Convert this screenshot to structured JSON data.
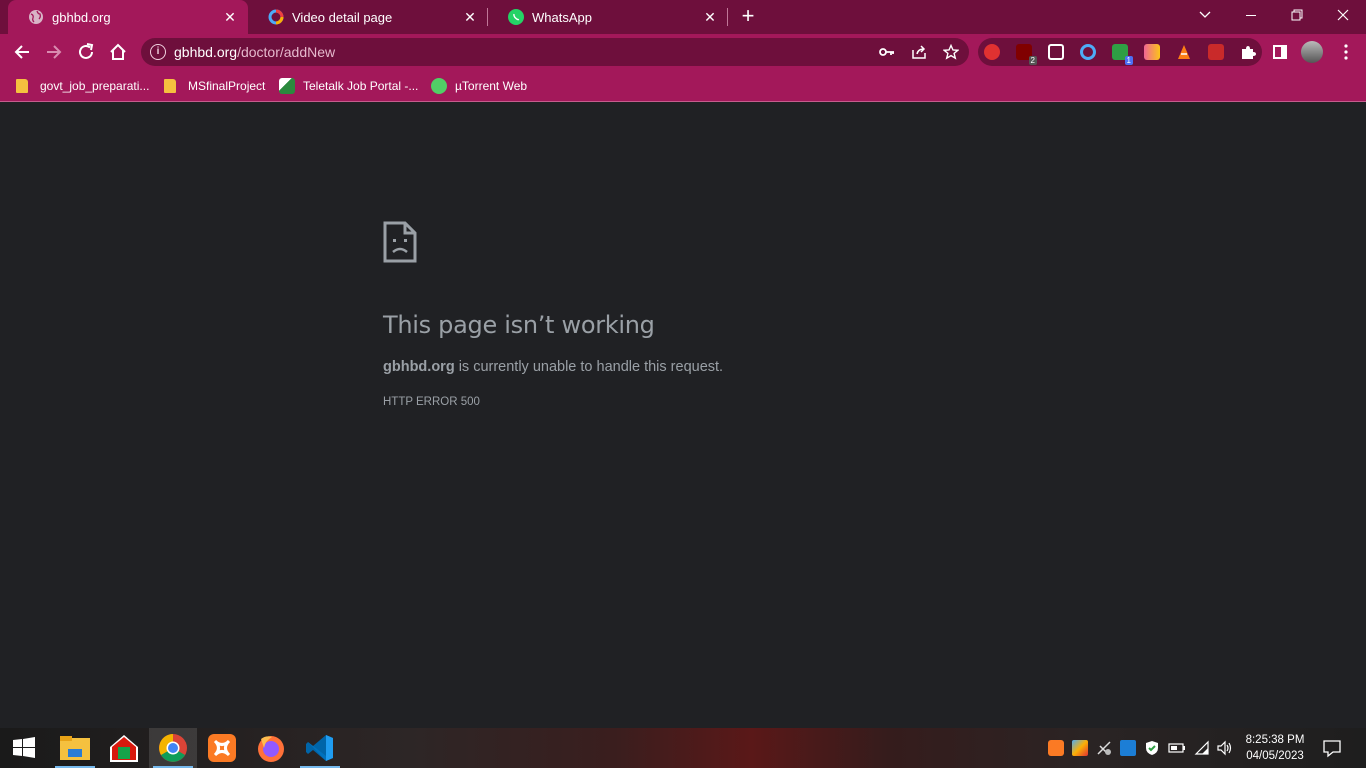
{
  "browser": {
    "tabs": [
      {
        "title": "gbhbd.org",
        "active": true,
        "icon": "globe-icon"
      },
      {
        "title": "Video detail page",
        "active": false,
        "icon": "colorful-ring-icon"
      },
      {
        "title": "WhatsApp",
        "active": false,
        "icon": "whatsapp-icon"
      }
    ],
    "new_tab_label": "+",
    "url_host": "gbhbd.org",
    "url_path": "/doctor/addNew",
    "extensions": [
      {
        "name": "stop-hand-icon",
        "badge": ""
      },
      {
        "name": "ublock-icon",
        "badge": "2"
      },
      {
        "name": "window-icon",
        "badge": ""
      },
      {
        "name": "ring-icon",
        "badge": ""
      },
      {
        "name": "green-flag-icon",
        "badge": "1"
      },
      {
        "name": "w-icon",
        "badge": ""
      },
      {
        "name": "cone-icon",
        "badge": ""
      },
      {
        "name": "book-icon",
        "badge": ""
      }
    ],
    "bookmarks": [
      {
        "label": "govt_job_preparati...",
        "icon": "folder-icon"
      },
      {
        "label": "MSfinalProject",
        "icon": "folder-icon"
      },
      {
        "label": "Teletalk Job Portal -...",
        "icon": "teletalk-icon"
      },
      {
        "label": "µTorrent Web",
        "icon": "utorrent-icon"
      }
    ],
    "colors": {
      "frame": "#6e0f3c",
      "toolbar": "#a3185a",
      "page_bg": "#202124",
      "error_text": "#9aa0a6"
    }
  },
  "error_page": {
    "title": "This page isn’t working",
    "host": "gbhbd.org",
    "message": " is currently unable to handle this request.",
    "code": "HTTP ERROR 500"
  },
  "taskbar": {
    "apps": [
      "start-icon",
      "file-explorer-icon",
      "app-house-icon",
      "chrome-icon",
      "xampp-icon",
      "firefox-icon",
      "vscode-icon"
    ],
    "time": "8:25:38 PM",
    "date": "04/05/2023"
  }
}
